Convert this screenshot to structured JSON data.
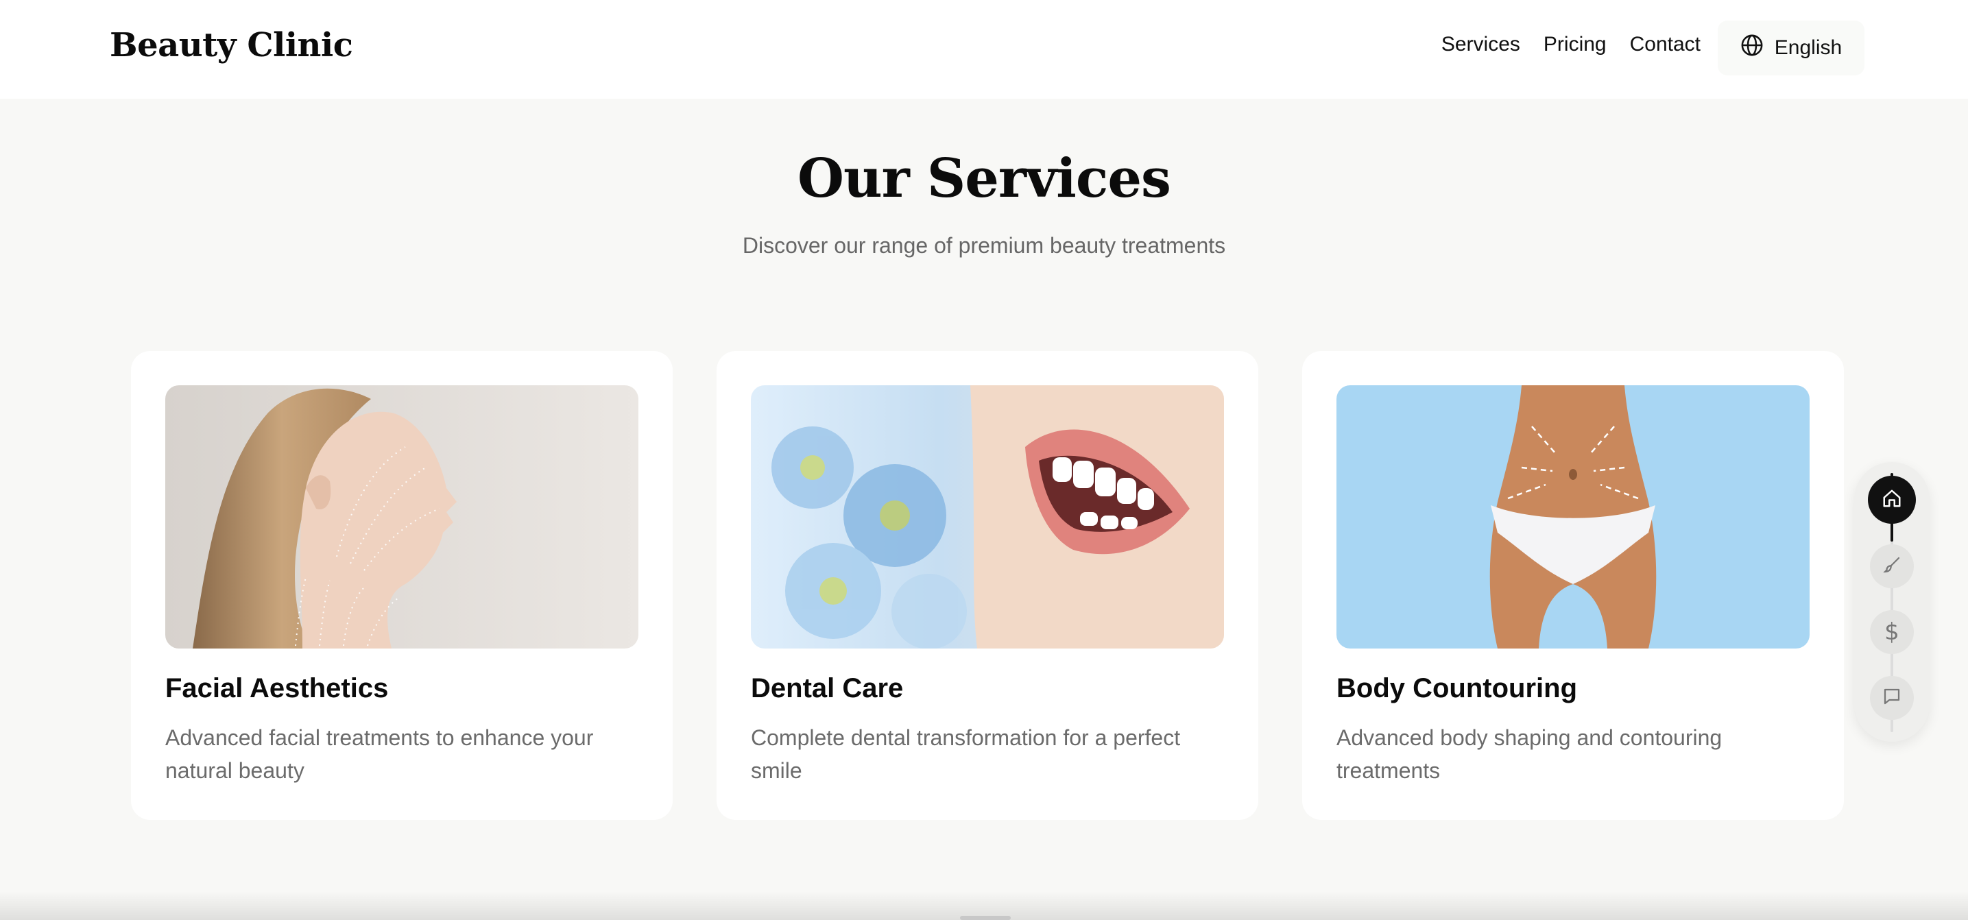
{
  "header": {
    "logo": "Beauty Clinic",
    "nav": [
      "Services",
      "Pricing",
      "Contact"
    ],
    "language": "English",
    "language_icon": "globe-icon"
  },
  "section": {
    "title": "Our Services",
    "subtitle": "Discover our range of premium beauty treatments"
  },
  "cards": [
    {
      "title": "Facial Aesthetics",
      "description": "Advanced facial treatments to enhance your natural beauty",
      "image": "woman-face-profile-with-lift-arrows"
    },
    {
      "title": "Dental Care",
      "description": "Complete dental transformation for a perfect smile",
      "image": "smiling-lips-with-white-teeth-and-flowers"
    },
    {
      "title": "Body Countouring",
      "description": "Advanced body shaping and contouring treatments",
      "image": "torso-with-contouring-arrows-blue-background"
    }
  ],
  "side_nav": {
    "items": [
      "home-icon",
      "brush-icon",
      "dollar-icon",
      "chat-icon"
    ],
    "active_index": 0
  },
  "colors": {
    "background": "#f8f8f6",
    "card": "#ffffff",
    "text_primary": "#0b0b0b",
    "text_secondary": "#6b6b6b",
    "accent_dark": "#111111",
    "body_image_bg": "#a8d6f3"
  }
}
